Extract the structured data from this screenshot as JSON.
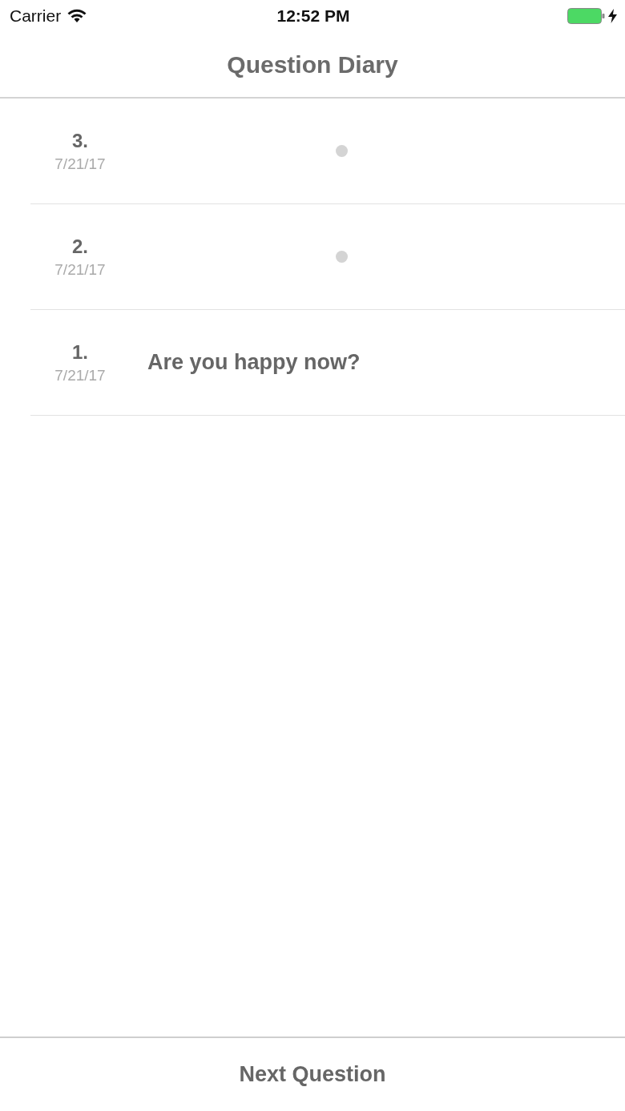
{
  "status_bar": {
    "carrier": "Carrier",
    "time": "12:52 PM",
    "charging": true
  },
  "nav": {
    "title": "Question Diary"
  },
  "entries": [
    {
      "number": "3.",
      "date": "7/21/17",
      "kind": "pending"
    },
    {
      "number": "2.",
      "date": "7/21/17",
      "kind": "pending"
    },
    {
      "number": "1.",
      "date": "7/21/17",
      "kind": "question",
      "question": "Are you happy now?"
    }
  ],
  "footer": {
    "button": "Next Question"
  }
}
